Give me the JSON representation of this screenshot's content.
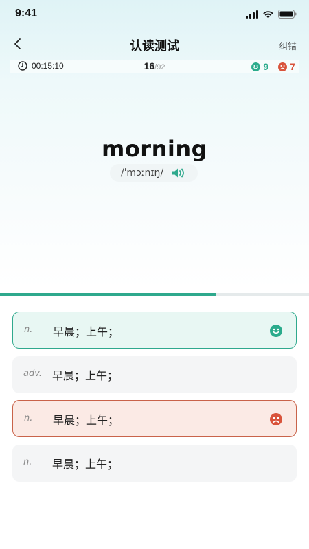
{
  "status_bar": {
    "time": "9:41"
  },
  "nav": {
    "title": "认读测试",
    "correct_label": "纠错"
  },
  "info": {
    "timer": "00:15:10",
    "progress_current": "16",
    "progress_total": "/92",
    "correct_count": "9",
    "wrong_count": "7"
  },
  "word": {
    "text": "morning",
    "phonetic": "/ˈmɔːnɪŋ/"
  },
  "progress_fraction": 0.7,
  "options": [
    {
      "pos": "n.",
      "meaning": "早晨；上午；",
      "state": "correct"
    },
    {
      "pos": "adv.",
      "meaning": "早晨；上午；",
      "state": "normal"
    },
    {
      "pos": "n.",
      "meaning": "早晨；上午；",
      "state": "wrong"
    },
    {
      "pos": "n.",
      "meaning": "早晨；上午；",
      "state": "normal"
    }
  ],
  "colors": {
    "accent": "#2fa98d",
    "correct": "#2bab8c",
    "wrong": "#d9533b"
  }
}
